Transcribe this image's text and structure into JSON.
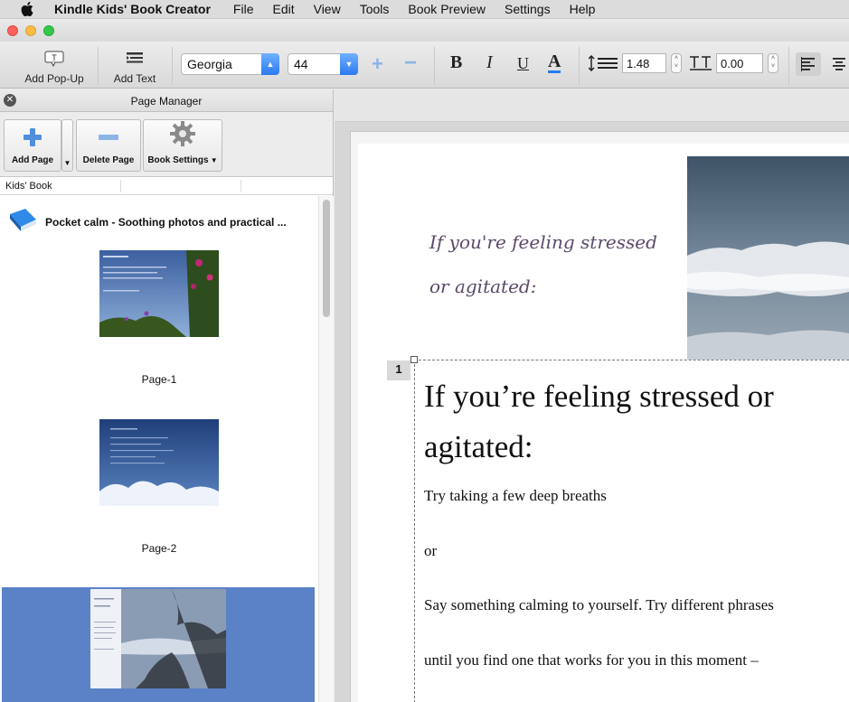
{
  "menubar": {
    "apple_icon": "apple-logo",
    "app_name": "Kindle Kids' Book Creator",
    "items": [
      "File",
      "Edit",
      "View",
      "Tools",
      "Book Preview",
      "Settings",
      "Help"
    ]
  },
  "toolbar": {
    "add_popup_label": "Add Pop-Up",
    "add_popup_icon_text": "T",
    "add_text_label": "Add Text",
    "font_family": "Georgia",
    "font_size": "44",
    "bold": "B",
    "italic": "I",
    "underline": "U",
    "color": "A",
    "line_spacing": "1.48",
    "letter_spacing": "0.00",
    "accent_color": "#2a7af0"
  },
  "page_manager": {
    "title": "Page Manager",
    "add_page_label": "Add Page",
    "delete_page_label": "Delete Page",
    "book_settings_label": "Book Settings",
    "column_header": "Kids' Book",
    "book_title": "Pocket calm - Soothing photos and practical ...",
    "pages": [
      {
        "label": "Page-1"
      },
      {
        "label": "Page-2"
      }
    ],
    "selected_color": "#5b82c7"
  },
  "canvas": {
    "header_line1": "If you're feeling stressed",
    "header_line2": "or agitated:",
    "page_number": "1",
    "heading": "If you’re feeling stressed or agitated:",
    "paragraphs": [
      "Try taking a few deep breaths",
      "or",
      "Say something calming to yourself. Try different phrases",
      "until you find one that works for you in this moment –"
    ]
  }
}
